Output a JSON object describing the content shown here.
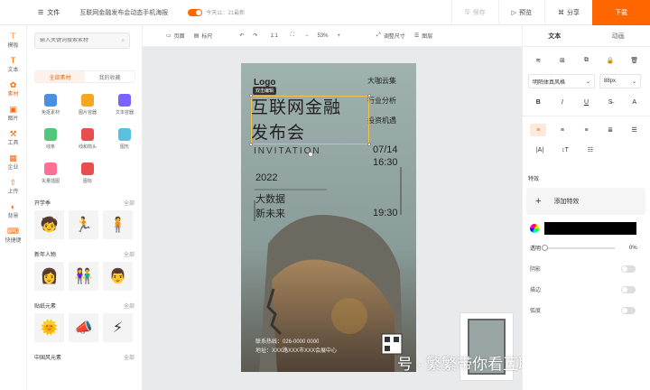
{
  "topbar": {
    "file_label": "文件",
    "doc_title": "互联网金融发布会动态手机海报",
    "save_status": "今天11：21最新",
    "save_label": "保存",
    "preview_label": "预览",
    "share_label": "分享",
    "download_label": "下载"
  },
  "leftnav": [
    {
      "label": "模板",
      "icon": "template-icon"
    },
    {
      "label": "文本",
      "icon": "text-icon"
    },
    {
      "label": "素材",
      "icon": "material-icon"
    },
    {
      "label": "图片",
      "icon": "image-icon"
    },
    {
      "label": "工具",
      "icon": "toolbox-icon"
    },
    {
      "label": "企业",
      "icon": "company-icon"
    },
    {
      "label": "上传",
      "icon": "upload-icon"
    },
    {
      "label": "背景",
      "icon": "background-icon"
    },
    {
      "label": "快捷键",
      "icon": "keyboard-icon"
    }
  ],
  "assets": {
    "search_placeholder": "输入关键词搜索素材",
    "tab_all": "全部素材",
    "tab_fav": "我的收藏",
    "tools": [
      {
        "label": "免抠素材",
        "color": "#4a90e2"
      },
      {
        "label": "图片容器",
        "color": "#f5a623"
      },
      {
        "label": "文本容器",
        "color": "#7b61ff"
      },
      {
        "label": "线条",
        "color": "#50c878"
      },
      {
        "label": "线和箭头",
        "color": "#e94e4e"
      },
      {
        "label": "图形",
        "color": "#5bc0de"
      },
      {
        "label": "矢量插图",
        "color": "#ff6f91"
      },
      {
        "label": "图标",
        "color": "#e94e4e"
      }
    ],
    "sections": [
      {
        "title": "开学季",
        "more": "全部"
      },
      {
        "title": "新年人物",
        "more": "全部"
      },
      {
        "title": "贴纸元素",
        "more": "全部"
      },
      {
        "title": "中国风元素",
        "more": "全部"
      }
    ]
  },
  "toolbar2": {
    "page_label": "页面",
    "ruler_label": "标尺",
    "ratio_label": "1:1",
    "zoom": "53%",
    "resize_label": "调整尺寸",
    "layer_label": "图层"
  },
  "poster": {
    "logo": "Logo",
    "tag": "双击编辑",
    "title_line1": "互联网金融",
    "title_line2": "发布会",
    "subtitle": "INVITATION",
    "right_text_1": "大咖云集",
    "right_text_2": "行业分析",
    "right_text_3": "投资机遇",
    "date": "07/14",
    "time1": "16:30",
    "year": "2022",
    "slogan1": "大数据",
    "slogan2": "新未来",
    "time2": "19:30",
    "contact_phone": "联系热线：026-0000 0000",
    "contact_addr": "地址：XXX路XXX市XXX会展中心"
  },
  "watermark": "号 · 繁繁带你看互联网营销",
  "props": {
    "tab_text": "文本",
    "tab_anim": "动画",
    "font_name": "明陌体真风格",
    "font_size": "88px",
    "effects_title": "特效",
    "add_effect": "添加特效",
    "opacity_label": "透明",
    "opacity_value": "0%",
    "shadow_label": "阴影",
    "stroke_label": "描边",
    "curve_label": "弧度"
  }
}
